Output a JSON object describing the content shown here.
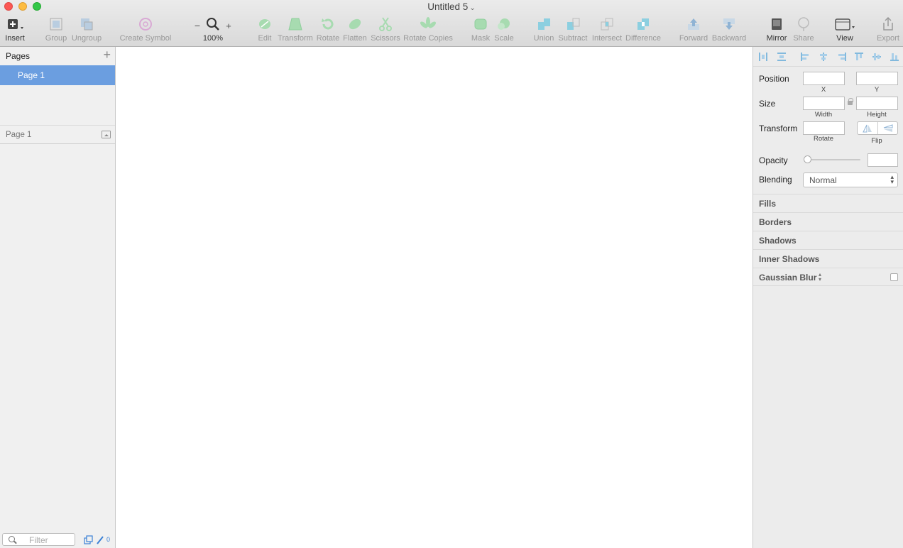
{
  "window": {
    "title": "Untitled 5"
  },
  "toolbar": {
    "insert": "Insert",
    "group": "Group",
    "ungroup": "Ungroup",
    "create_symbol": "Create Symbol",
    "zoom_minus": "−",
    "zoom_plus": "+",
    "zoom_level": "100%",
    "edit": "Edit",
    "transform": "Transform",
    "rotate": "Rotate",
    "flatten": "Flatten",
    "scissors": "Scissors",
    "rotate_copies": "Rotate Copies",
    "mask": "Mask",
    "scale": "Scale",
    "union": "Union",
    "subtract": "Subtract",
    "intersect": "Intersect",
    "difference": "Difference",
    "forward": "Forward",
    "backward": "Backward",
    "mirror": "Mirror",
    "share": "Share",
    "view": "View",
    "export": "Export"
  },
  "sidebar": {
    "pages_title": "Pages",
    "add": "+",
    "pages": [
      {
        "label": "Page 1"
      }
    ],
    "layers_title": "Page 1",
    "filter_placeholder": "Filter",
    "count": "0"
  },
  "inspector": {
    "position": "Position",
    "x": "X",
    "y": "Y",
    "size": "Size",
    "width": "Width",
    "height": "Height",
    "transform": "Transform",
    "rotate": "Rotate",
    "flip": "Flip",
    "opacity": "Opacity",
    "blending": "Blending",
    "blend_mode": "Normal",
    "sections": [
      "Fills",
      "Borders",
      "Shadows",
      "Inner Shadows",
      "Gaussian Blur"
    ]
  },
  "colors": {
    "selection": "#6b9ee0",
    "accent": "#3a80d6",
    "icon_green": "#8fcf9c",
    "icon_teal": "#5ebbd6"
  }
}
